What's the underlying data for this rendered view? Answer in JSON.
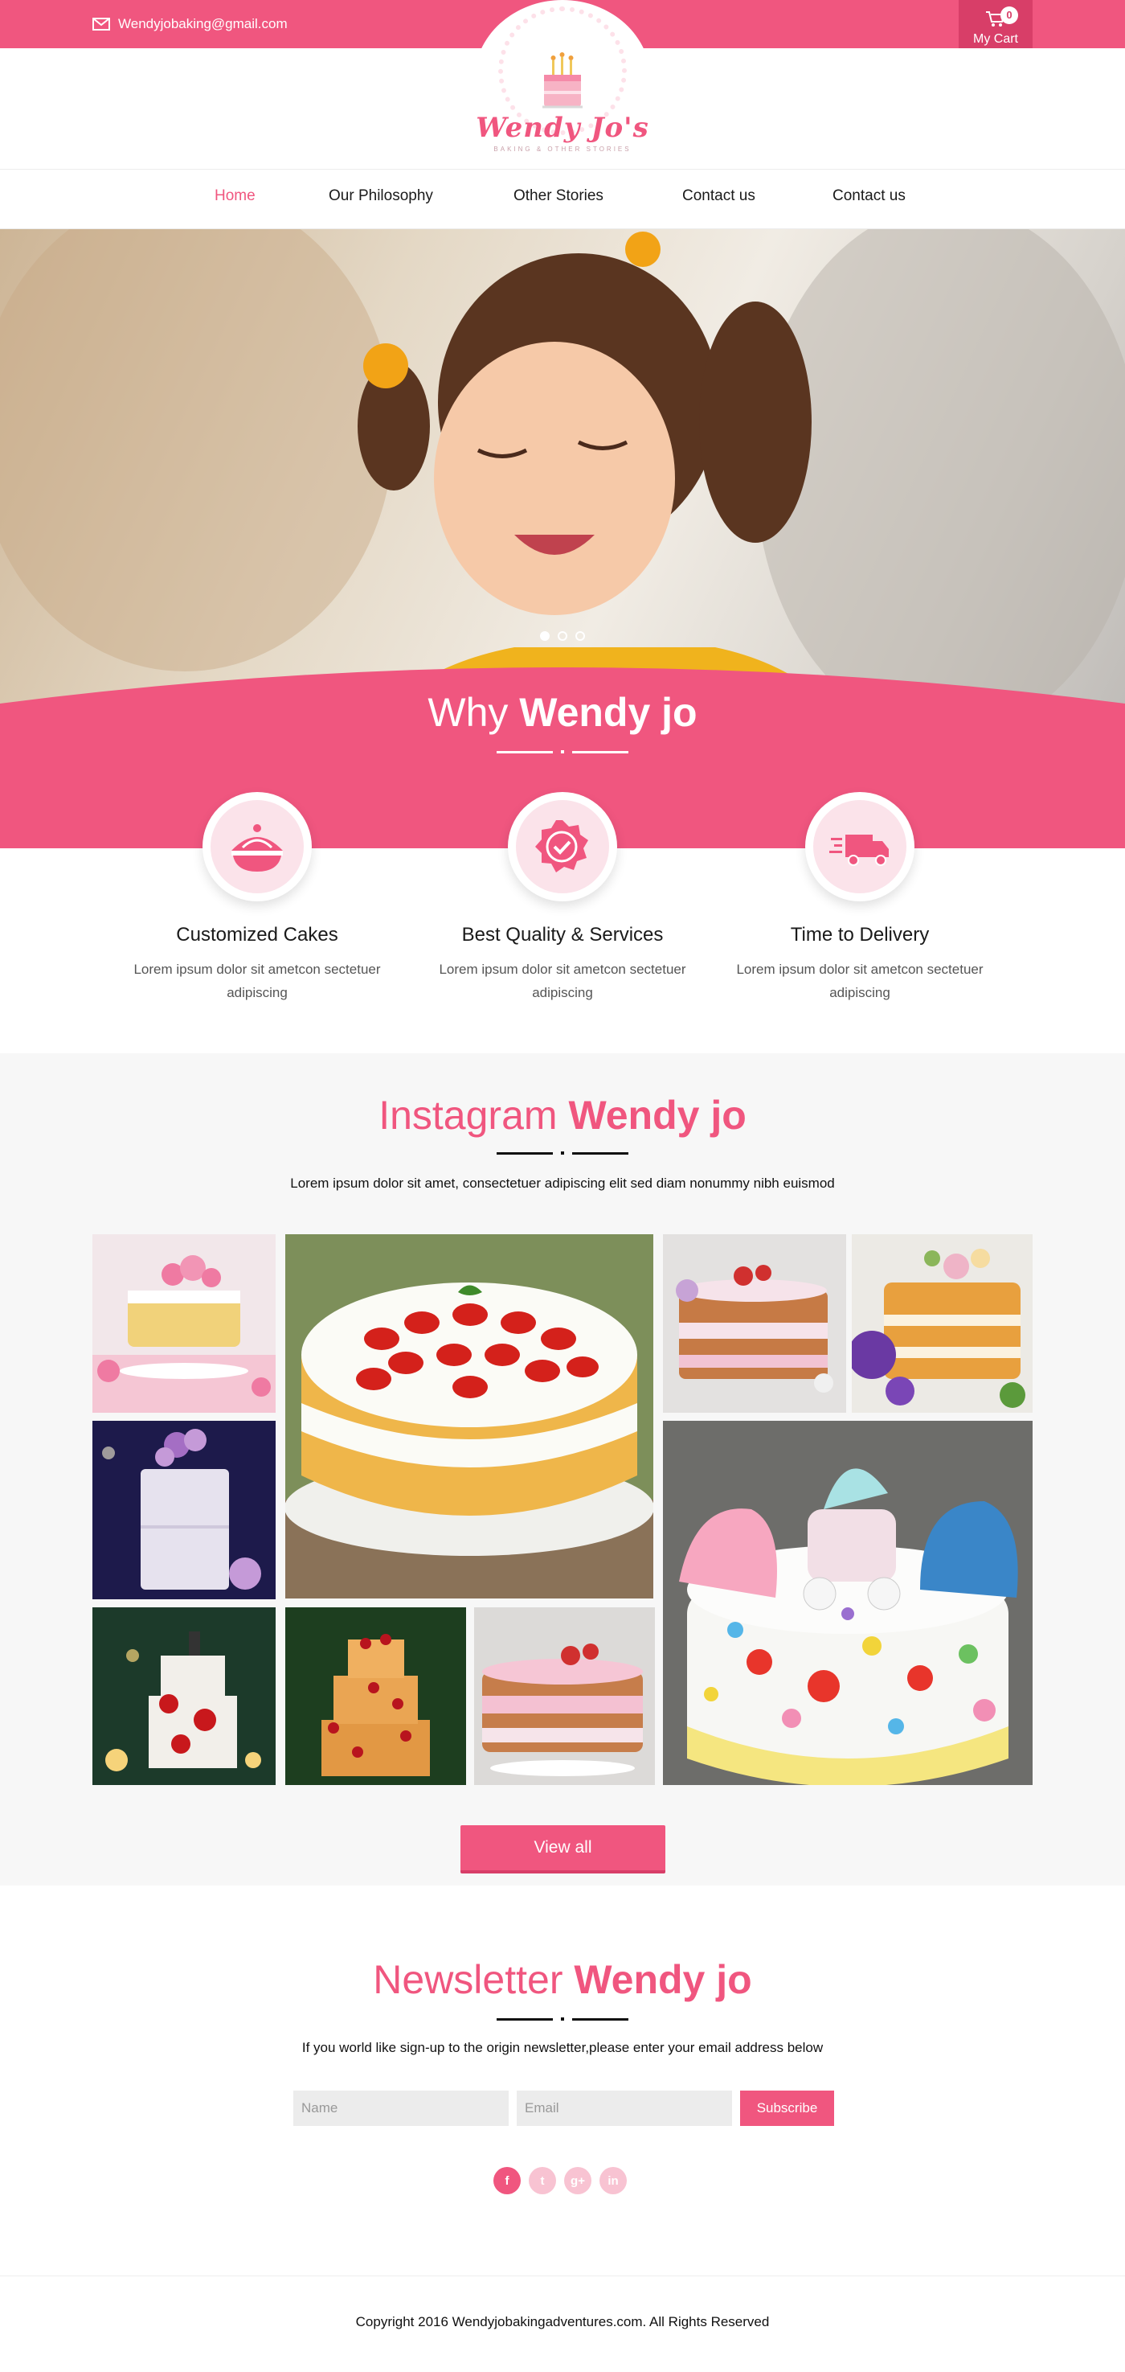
{
  "topbar": {
    "email": "Wendyjobaking@gmail.com",
    "cart_label": "My Cart",
    "cart_count": "0"
  },
  "logo": {
    "brand": "Wendy Jo's",
    "tagline": "BAKING & OTHER STORIES"
  },
  "nav": {
    "items": [
      {
        "label": "Home",
        "active": true
      },
      {
        "label": "Our Philosophy",
        "active": false
      },
      {
        "label": "Other Stories",
        "active": false
      },
      {
        "label": "Contact us",
        "active": false
      },
      {
        "label": "Contact us",
        "active": false
      }
    ]
  },
  "hero": {
    "slides": 3,
    "active_slide": 1
  },
  "why": {
    "title_light": "Why",
    "title_bold": "Wendy jo",
    "features": [
      {
        "title": "Customized Cakes",
        "text": "Lorem ipsum dolor sit ametcon sectetuer adipiscing",
        "icon": "cake-icon"
      },
      {
        "title": "Best Quality & Services",
        "text": "Lorem ipsum dolor sit ametcon sectetuer adipiscing",
        "icon": "quality-badge-icon"
      },
      {
        "title": "Time to Delivery",
        "text": "Lorem ipsum dolor sit ametcon sectetuer adipiscing",
        "icon": "delivery-truck-icon"
      }
    ]
  },
  "instagram": {
    "title_light": "Instagram",
    "title_bold": "Wendy jo",
    "subtitle": "Lorem ipsum dolor sit amet, consectetuer adipiscing elit sed diam nonummy nibh euismod",
    "view_all": "View all"
  },
  "newsletter": {
    "title_light": "Newsletter",
    "title_bold": "Wendy jo",
    "subtitle": "If you world like sign-up to the origin newsletter,please enter your email address below",
    "name_placeholder": "Name",
    "email_placeholder": "Email",
    "button": "Subscribe",
    "socials": [
      {
        "glyph": "f",
        "icon": "facebook-icon"
      },
      {
        "glyph": "t",
        "icon": "twitter-icon"
      },
      {
        "glyph": "g+",
        "icon": "google-plus-icon"
      },
      {
        "glyph": "in",
        "icon": "linkedin-icon"
      }
    ]
  },
  "footer": {
    "copyright": "Copyright 2016 Wendyjobakingadventures.com. All Rights Reserved"
  },
  "colors": {
    "accent": "#f0567f",
    "accent_dark": "#d83e68",
    "section_bg": "#f7f7f7"
  }
}
